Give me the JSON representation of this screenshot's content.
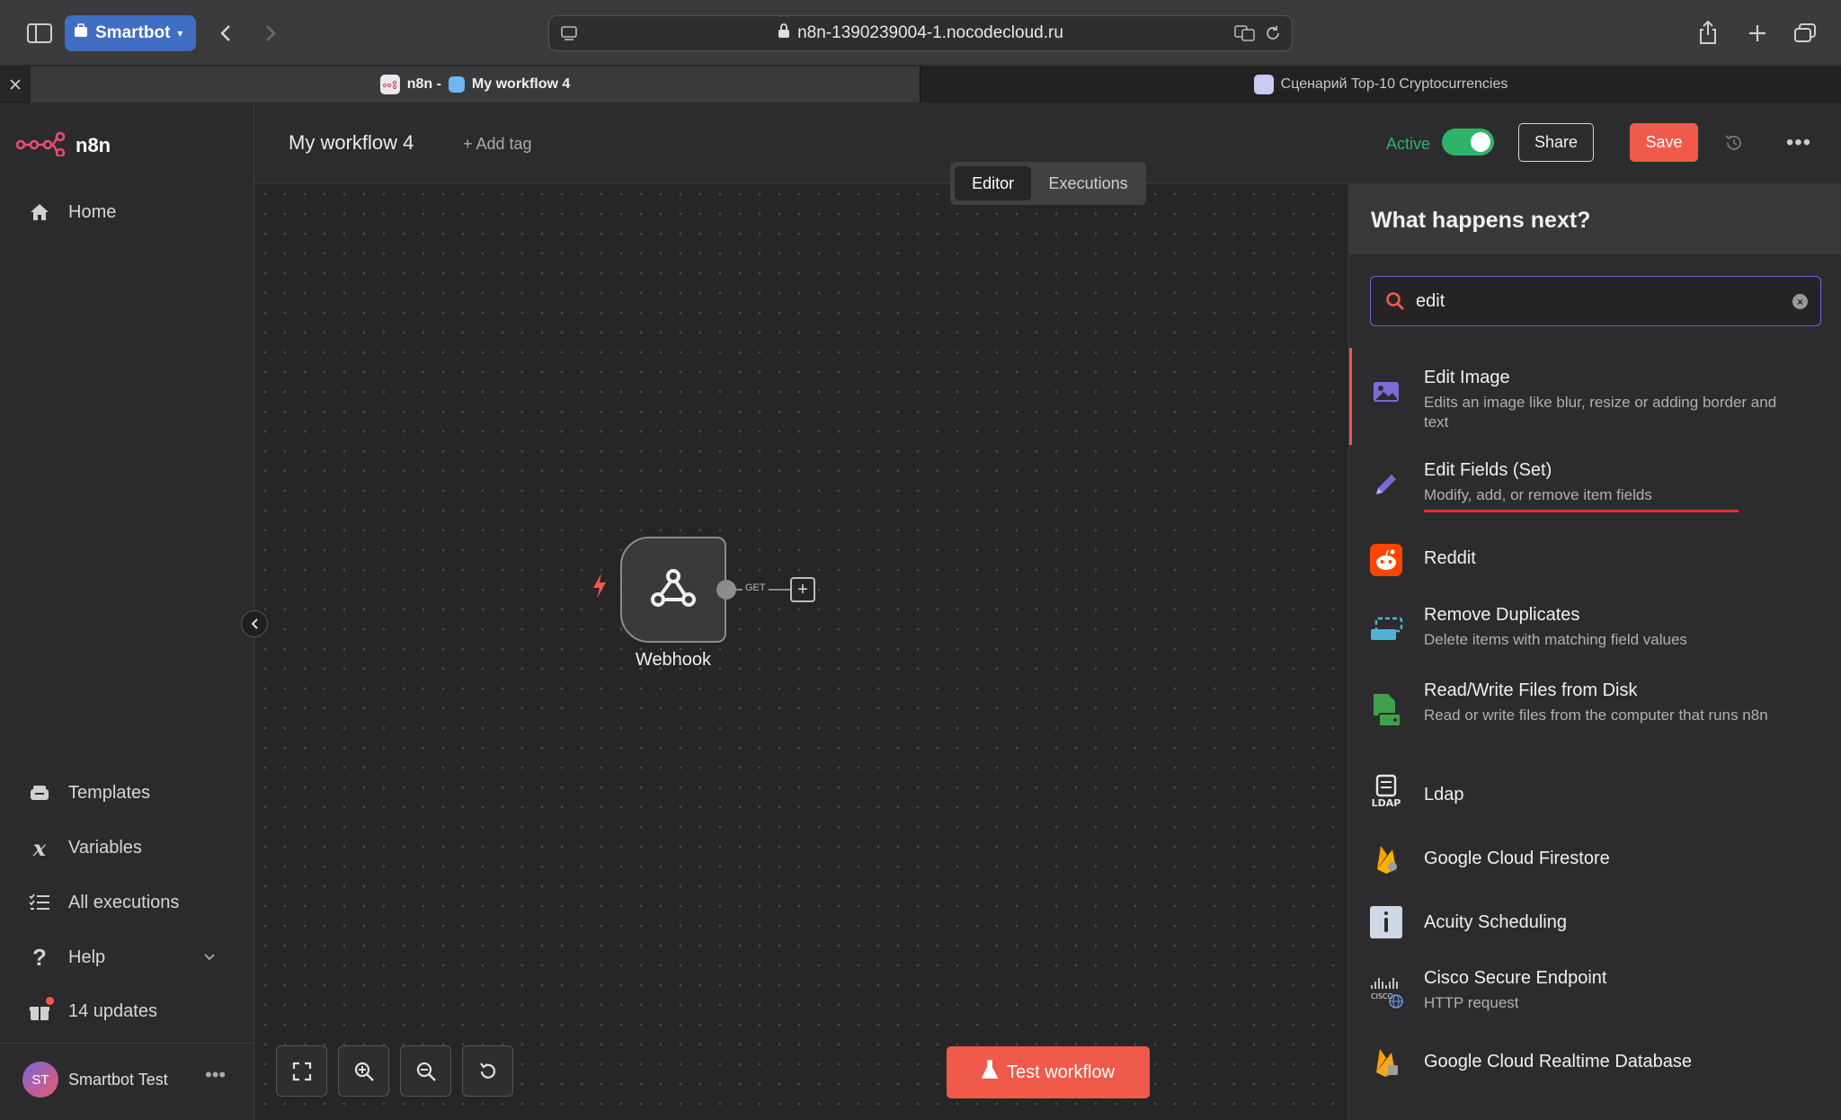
{
  "browser": {
    "profile_label": "Smartbot",
    "url": "n8n-1390239004-1.nocodecloud.ru",
    "tabs": [
      {
        "label": "n8n - ",
        "label2": "My workflow 4"
      },
      {
        "label": "Сценарий Top-10 Cryptocurrencies"
      }
    ]
  },
  "sidebar": {
    "logo_text": "n8n",
    "top_items": [
      {
        "label": "Home",
        "icon": "home-icon"
      }
    ],
    "bottom_items": [
      {
        "label": "Templates",
        "icon": "templates-icon"
      },
      {
        "label": "Variables",
        "icon": "variables-icon"
      },
      {
        "label": "All executions",
        "icon": "executions-list-icon"
      },
      {
        "label": "Help",
        "icon": "help-icon"
      },
      {
        "label": "14 updates",
        "icon": "gift-icon"
      }
    ],
    "user": {
      "initials": "ST",
      "name": "Smartbot Test"
    }
  },
  "header": {
    "workflow_title": "My workflow 4",
    "add_tag_label": "+ Add tag",
    "active_label": "Active",
    "active": true,
    "share_label": "Share",
    "save_label": "Save",
    "mode_tabs": [
      {
        "label": "Editor",
        "active": true
      },
      {
        "label": "Executions",
        "active": false
      }
    ]
  },
  "canvas": {
    "node": {
      "label": "Webhook",
      "edge_label": "GET"
    },
    "test_button_label": "Test workflow"
  },
  "panel": {
    "title": "What happens next?",
    "search_value": "edit",
    "results": [
      {
        "name": "Edit Image",
        "desc": "Edits an image like blur, resize or adding border and text",
        "icon": "image-icon",
        "color": "#7d6ad9"
      },
      {
        "name": "Edit Fields (Set)",
        "desc": "Modify, add, or remove item fields",
        "icon": "pencil-icon",
        "color": "#7d6ad9"
      },
      {
        "name": "Reddit",
        "desc": "",
        "icon": "reddit-icon",
        "color": "#ff4500"
      },
      {
        "name": "Remove Duplicates",
        "desc": "Delete items with matching field values",
        "icon": "remove-duplicates-icon",
        "color": "#4fb3d9"
      },
      {
        "name": "Read/Write Files from Disk",
        "desc": "Read or write files from the computer that runs n8n",
        "icon": "file-disk-icon",
        "color": "#3fa14b"
      },
      {
        "name": "Ldap",
        "desc": "",
        "icon": "ldap-icon",
        "color": "#e6e6e6"
      },
      {
        "name": "Google Cloud Firestore",
        "desc": "",
        "icon": "firestore-icon",
        "color": "#f5b400"
      },
      {
        "name": "Acuity Scheduling",
        "desc": "",
        "icon": "acuity-icon",
        "color": "#cfd6e6"
      },
      {
        "name": "Cisco Secure Endpoint",
        "desc": "HTTP request",
        "icon": "cisco-icon",
        "color": "#e6e6e6"
      },
      {
        "name": "Google Cloud Realtime Database",
        "desc": "",
        "icon": "firebase-icon",
        "color": "#f5a623"
      }
    ]
  },
  "colors": {
    "accent": "#f05a4a",
    "active_green": "#2fb36b",
    "annotation_red": "#e52f25"
  }
}
